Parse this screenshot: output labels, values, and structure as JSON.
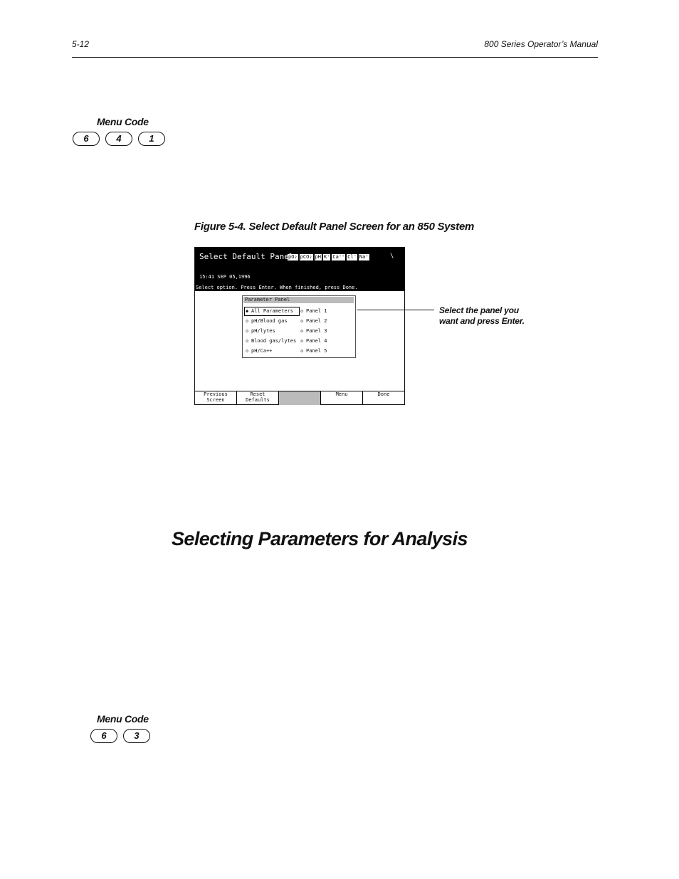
{
  "header": {
    "page_number": "5-12",
    "manual_title": "800 Series Operator’s Manual"
  },
  "menu_code_1": {
    "label": "Menu Code",
    "keys": [
      "6",
      "4",
      "1"
    ]
  },
  "figure": {
    "caption": "Figure 5-4. Select Default Panel Screen for an 850 System"
  },
  "screen": {
    "title": "Select Default Panel",
    "params": [
      "pO₂",
      "pCO₂",
      "pH",
      "K⁺",
      "Ca⁺⁺",
      "Cl⁻",
      "Na⁺"
    ],
    "slash": "\\",
    "datetime": "15:41 SEP 05,1996",
    "instruction": "Select option. Press Enter. When finished, press Done.",
    "panel_title": "Parameter Panel",
    "left_options": [
      "All Parameters",
      "pH/Blood gas",
      "pH/lytes",
      "Blood gas/lytes",
      "pH/Ca++"
    ],
    "right_options": [
      "Panel 1",
      "Panel 2",
      "Panel 3",
      "Panel 4",
      "Panel 5"
    ],
    "softkeys": [
      {
        "line1": "Previous",
        "line2": "Screen"
      },
      {
        "line1": "Reset",
        "line2": "Defaults"
      },
      {
        "line1": "",
        "line2": ""
      },
      {
        "line1": "Menu",
        "line2": ""
      },
      {
        "line1": "Done",
        "line2": ""
      }
    ]
  },
  "callout": {
    "line1": "Select the panel you",
    "line2": "want and press Enter."
  },
  "section": {
    "heading": "Selecting Parameters for Analysis"
  },
  "menu_code_2": {
    "label": "Menu Code",
    "keys": [
      "6",
      "3"
    ]
  }
}
